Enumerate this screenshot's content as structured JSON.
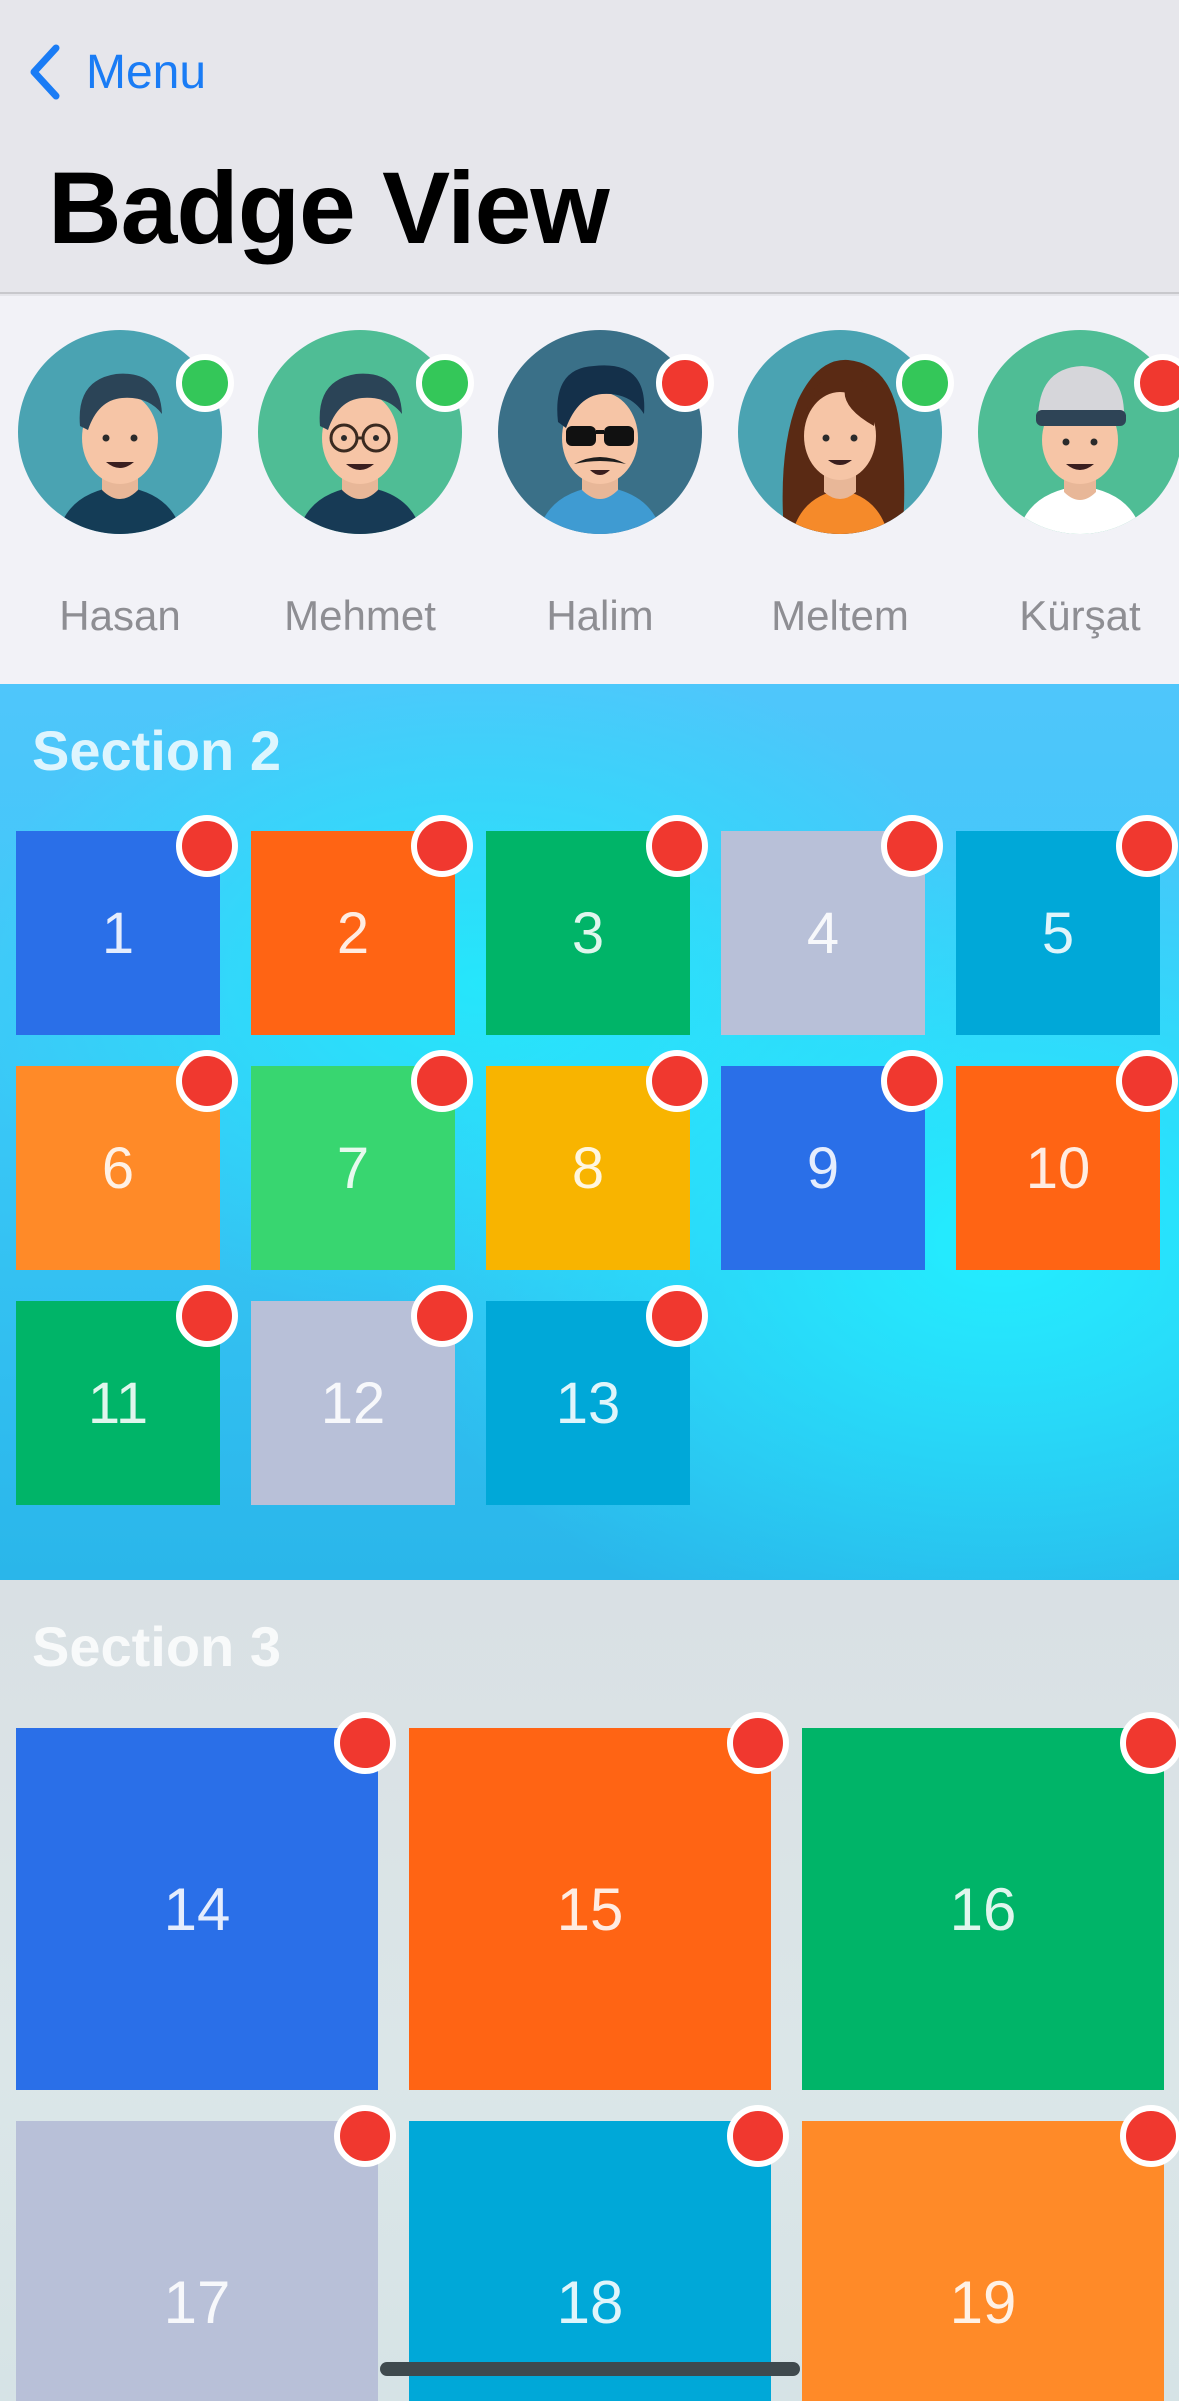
{
  "nav": {
    "back_label": "Menu",
    "title": "Badge View"
  },
  "colors": {
    "accent": "#1a7cf5",
    "online": "#34c759",
    "badge": "#f0382f",
    "blue": "#2a6fe8",
    "orange": "#ff6414",
    "green": "#00b468",
    "gray": "#b8c0d8",
    "cyan": "#00a8d8",
    "light_orange": "#ff8a28",
    "light_green": "#38d670",
    "yellow": "#f8b400"
  },
  "avatars": [
    {
      "name": "Hasan",
      "status": "online",
      "icon": "man-avatar-icon"
    },
    {
      "name": "Mehmet",
      "status": "online",
      "icon": "man-glasses-avatar-icon"
    },
    {
      "name": "Halim",
      "status": "busy",
      "icon": "man-sunglasses-mustache-avatar-icon"
    },
    {
      "name": "Meltem",
      "status": "online",
      "icon": "woman-avatar-icon"
    },
    {
      "name": "Kürşat",
      "status": "busy",
      "icon": "man-cap-avatar-icon"
    }
  ],
  "section2": {
    "title": "Section 2",
    "tiles": [
      {
        "label": "1",
        "color": "#2a6fe8"
      },
      {
        "label": "2",
        "color": "#ff6414"
      },
      {
        "label": "3",
        "color": "#00b468"
      },
      {
        "label": "4",
        "color": "#b8c0d8"
      },
      {
        "label": "5",
        "color": "#00a8d8"
      },
      {
        "label": "6",
        "color": "#ff8a28"
      },
      {
        "label": "7",
        "color": "#38d670"
      },
      {
        "label": "8",
        "color": "#f8b400"
      },
      {
        "label": "9",
        "color": "#2a6fe8"
      },
      {
        "label": "10",
        "color": "#ff6414"
      },
      {
        "label": "11",
        "color": "#00b468"
      },
      {
        "label": "12",
        "color": "#b8c0d8"
      },
      {
        "label": "13",
        "color": "#00a8d8"
      }
    ]
  },
  "section3": {
    "title": "Section 3",
    "tiles": [
      {
        "label": "14",
        "color": "#2a6fe8"
      },
      {
        "label": "15",
        "color": "#ff6414"
      },
      {
        "label": "16",
        "color": "#00b468"
      },
      {
        "label": "17",
        "color": "#b8c0d8"
      },
      {
        "label": "18",
        "color": "#00a8d8"
      },
      {
        "label": "19",
        "color": "#ff8a28"
      }
    ]
  }
}
